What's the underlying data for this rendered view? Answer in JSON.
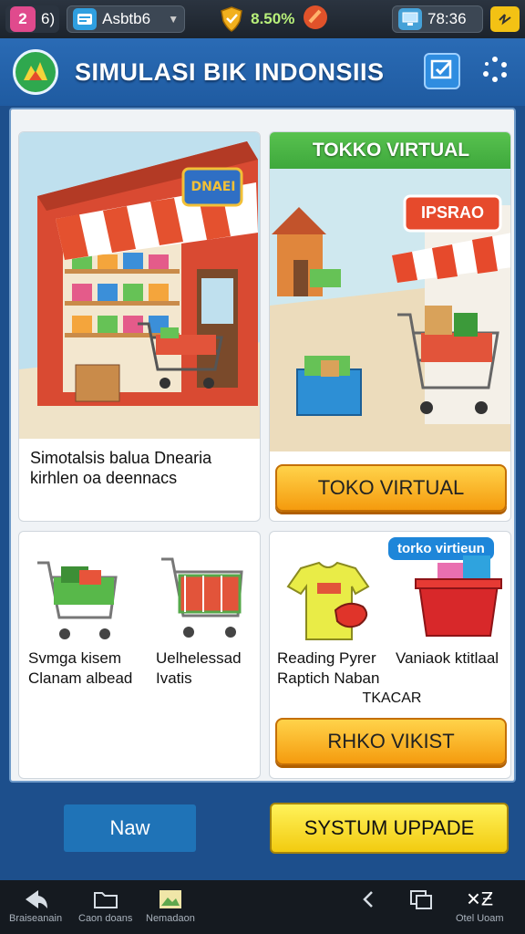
{
  "status_bar": {
    "badge": "2",
    "badge_sub": "6)",
    "account_label": "Asbtb6",
    "percent": "8.50%",
    "time": "78:36"
  },
  "header": {
    "title": "SIMULASI BIK INDONSIIS"
  },
  "cards": {
    "store": {
      "sign": "DNAEI",
      "caption_line1": "Simotalsis balua Dnearia",
      "caption_line2": "kirhlen oa deennacs"
    },
    "toko": {
      "title": "TOKKO VIRTUAL",
      "sign": "IPSRAO",
      "button": "TOKO VIRTUAL"
    },
    "carts": {
      "caption_left_1": "Svmga kisem",
      "caption_left_2": "Clanam albead",
      "caption_right_1": "Uelhelessad",
      "caption_right_2": "Ivatis"
    },
    "products": {
      "ribbon": "torko virtieun",
      "caption_left_1": "Reading Pyrer",
      "caption_left_2": "Raptich Naban",
      "caption_right": "Vaniaok ktitlaal",
      "caption_center": "TKACAR",
      "button": "RHKO VIKIST"
    }
  },
  "actions": {
    "new": "Naw",
    "system_update": "SYSTUM UPPADE"
  },
  "navbar": {
    "items": [
      "Braiseanain",
      "Caon doans",
      "Nemadaon"
    ],
    "right_label": "Otel Uoam"
  },
  "colors": {
    "header_blue": "#2a6bb5",
    "panel_border": "#6e9ac9",
    "orange_button": "#f59b0e",
    "yellow_button": "#f2cb10",
    "title_green": "#3ea83c"
  }
}
